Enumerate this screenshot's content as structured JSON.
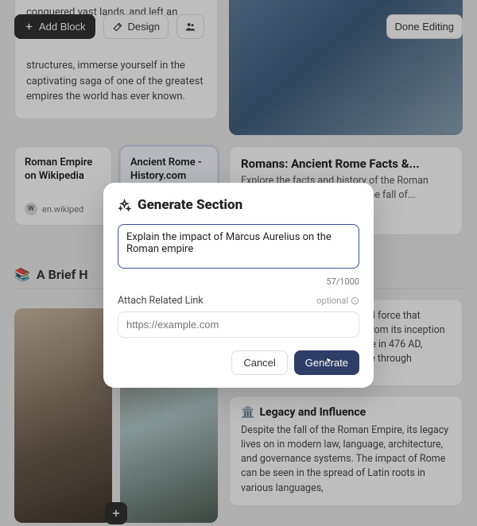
{
  "toolbar": {
    "add_block": "Add Block",
    "design": "Design",
    "done": "Done Editing"
  },
  "intro": {
    "text_top": "conquered vast lands, and left an enduring",
    "text_rest": "structures, immerse yourself in the captivating saga of one of the greatest empires the world has ever known."
  },
  "link_cards": [
    {
      "title": "Roman Empire on Wikipedia",
      "favicon": "W",
      "domain": "en.wikiped"
    },
    {
      "title": "Ancient Rome - History.com",
      "favicon": "",
      "domain": ""
    }
  ],
  "facts": {
    "title": "Romans: Ancient Rome Facts &...",
    "body": "Explore the facts and history of the Roman Empire, from its founding to the fall of..."
  },
  "section_heading": "A Brief H",
  "story": {
    "body": "over 500 years, was a colossal force that reshaped the ancient world. From its inception in 27 BC to its eventual decline in 476 AD, Romans spread their influence through"
  },
  "legacy": {
    "icon": "🏛️",
    "title": "Legacy and Influence",
    "body": "Despite the fall of the Roman Empire, its legacy lives on in modern law, language, architecture, and governance systems. The impact of Rome can be seen in the spread of Latin roots in various languages,"
  },
  "modal": {
    "title": "Generate Section",
    "prompt_value": "Explain the impact of Marcus Aurelius on the Roman empire",
    "char_count": "57/1000",
    "link_label": "Attach Related Link",
    "optional": "optional",
    "link_placeholder": "https://example.com",
    "cancel": "Cancel",
    "generate": "Generate"
  }
}
